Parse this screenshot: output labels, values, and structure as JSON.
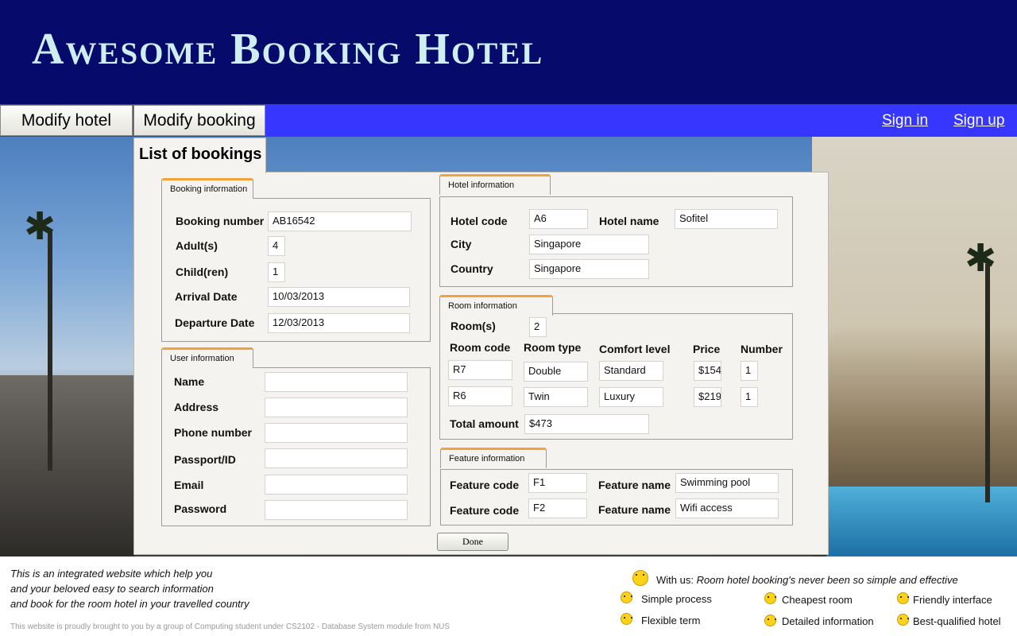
{
  "header": {
    "title": "Awesome Booking Hotel"
  },
  "nav": {
    "modify_hotel": "Modify hotel",
    "modify_booking": "Modify booking",
    "sign_in": "Sign in",
    "sign_up": "Sign up"
  },
  "list_tab": "List of bookings",
  "booking_info": {
    "title": "Booking information",
    "booking_number_label": "Booking number",
    "booking_number": "AB16542",
    "adults_label": "Adult(s)",
    "adults": "4",
    "children_label": "Child(ren)",
    "children": "1",
    "arrival_label": "Arrival Date",
    "arrival": "10/03/2013",
    "departure_label": "Departure Date",
    "departure": "12/03/2013"
  },
  "user_info": {
    "title": "User information",
    "name_label": "Name",
    "name": "",
    "address_label": "Address",
    "address": "",
    "phone_label": "Phone number",
    "phone": "",
    "passport_label": "Passport/ID",
    "passport": "",
    "email_label": "Email",
    "email": "",
    "password_label": "Password",
    "password": ""
  },
  "hotel_info": {
    "title": "Hotel information",
    "hotel_code_label": "Hotel code",
    "hotel_code": "A6",
    "hotel_name_label": "Hotel name",
    "hotel_name": "Sofitel",
    "city_label": "City",
    "city": "Singapore",
    "country_label": "Country",
    "country": "Singapore"
  },
  "room_info": {
    "title": "Room information",
    "rooms_label": "Room(s)",
    "rooms": "2",
    "columns": [
      "Room code",
      "Room type",
      "Comfort level",
      "Price",
      "Number"
    ],
    "rows": [
      {
        "code": "R7",
        "type": "Double",
        "comfort": "Standard",
        "price": "$154",
        "number": "1"
      },
      {
        "code": "R6",
        "type": "Twin",
        "comfort": "Luxury",
        "price": "$219",
        "number": "1"
      }
    ],
    "total_label": "Total amount",
    "total": "$473"
  },
  "feature_info": {
    "title": "Feature information",
    "code_label": "Feature code",
    "name_label": "Feature name",
    "rows": [
      {
        "code": "F1",
        "name": "Swimming pool"
      },
      {
        "code": "F2",
        "name": "Wifi access"
      }
    ]
  },
  "done_label": "Done",
  "footer": {
    "intro_line1": "This is an integrated website which help you",
    "intro_line2": "and your beloved easy to search information",
    "intro_line3": "and book for the room hotel in your travelled country",
    "credit": "This website is proudly brought to you by a group of Computing student under CS2102 - Database System module from NUS",
    "with_us_label": "With us:",
    "with_us_text": "Room hotel booking's never been so simple and effective",
    "features": [
      "Simple process",
      "Cheapest room",
      "Friendly interface",
      "Flexible term",
      "Detailed information",
      "Best-qualified hotel"
    ]
  },
  "colors": {
    "header_bg": "#050a6b",
    "nav_bg": "#3636ff",
    "title_color": "#cfeef0",
    "tab_accent": "#f2a33a"
  }
}
